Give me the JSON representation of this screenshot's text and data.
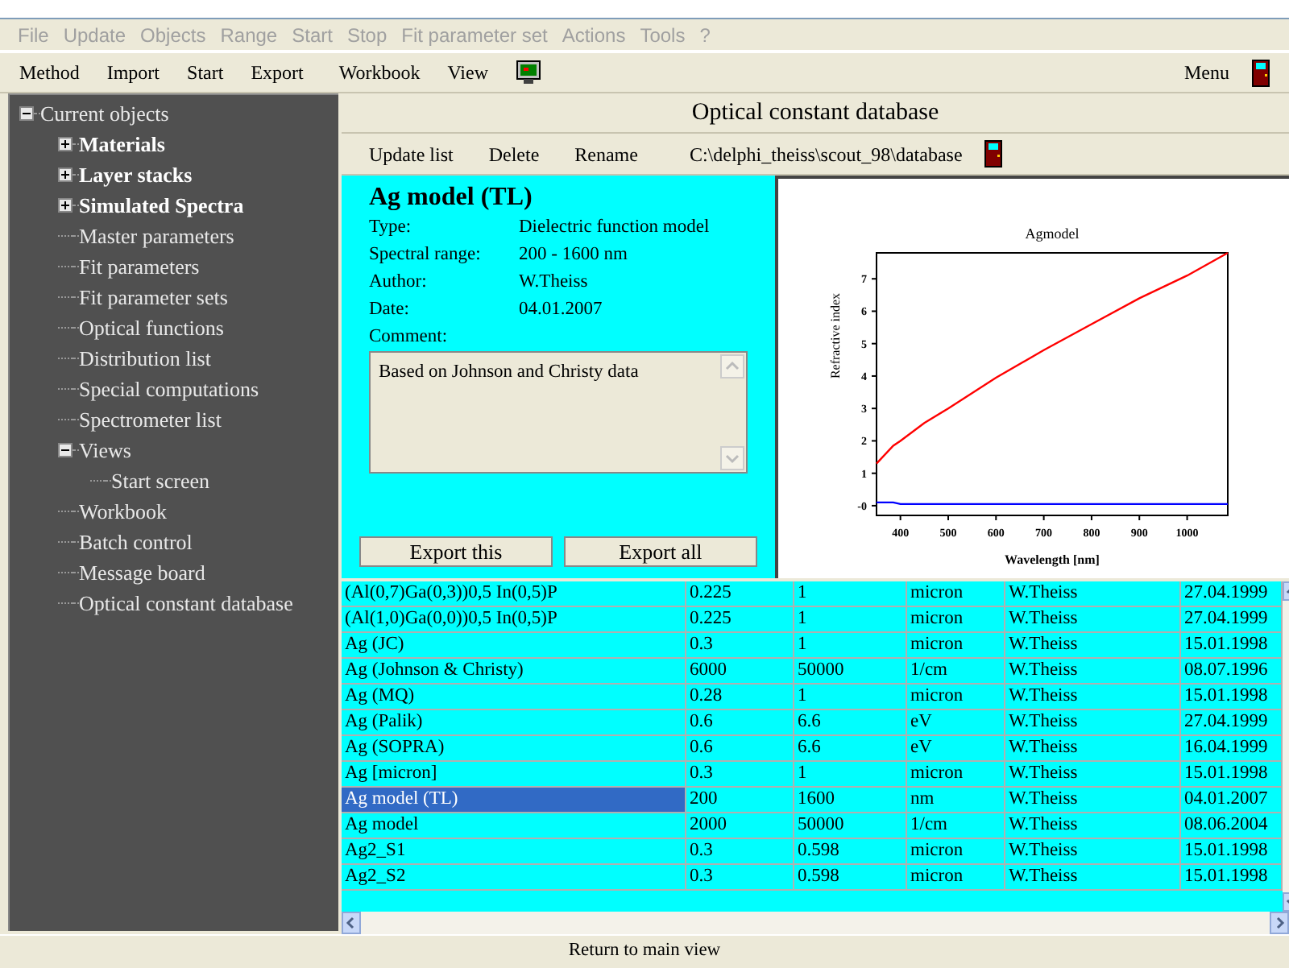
{
  "menu_bar": [
    "File",
    "Update",
    "Objects",
    "Range",
    "Start",
    "Stop",
    "Fit parameter set",
    "Actions",
    "Tools",
    "?"
  ],
  "toolbar": {
    "left": [
      "Method",
      "Import",
      "Start",
      "Export",
      "Workbook",
      "View"
    ],
    "right": "Menu"
  },
  "tree": {
    "label": "Current objects",
    "expanded": true,
    "children": [
      {
        "label": "Materials",
        "kind": "category",
        "expanded": false
      },
      {
        "label": "Layer stacks",
        "kind": "category",
        "expanded": false
      },
      {
        "label": "Simulated Spectra",
        "kind": "category",
        "expanded": false
      },
      {
        "label": "Master parameters",
        "kind": "item"
      },
      {
        "label": "Fit parameters",
        "kind": "item"
      },
      {
        "label": "Fit parameter sets",
        "kind": "item"
      },
      {
        "label": "Optical functions",
        "kind": "item"
      },
      {
        "label": "Distribution list",
        "kind": "item"
      },
      {
        "label": "Special computations",
        "kind": "item"
      },
      {
        "label": "Spectrometer list",
        "kind": "item"
      },
      {
        "label": "Views",
        "kind": "item",
        "expanded": true,
        "children": [
          {
            "label": "Start screen",
            "kind": "item"
          }
        ]
      },
      {
        "label": "Workbook",
        "kind": "item"
      },
      {
        "label": "Batch control",
        "kind": "item"
      },
      {
        "label": "Message board",
        "kind": "item"
      },
      {
        "label": "Optical constant database",
        "kind": "item"
      }
    ]
  },
  "panel": {
    "title": "Optical constant database",
    "toolbar": [
      "Update list",
      "Delete",
      "Rename"
    ],
    "path": "C:\\delphi_theiss\\scout_98\\database",
    "details": {
      "name": "Ag model (TL)",
      "fields": [
        {
          "label": "Type:",
          "value": "Dielectric function model"
        },
        {
          "label": "Spectral range:",
          "value": "200 - 1600 nm"
        },
        {
          "label": "Author:",
          "value": "W.Theiss"
        },
        {
          "label": "Date:",
          "value": "04.01.2007"
        }
      ],
      "comment_label": "Comment:",
      "comment": "Based on Johnson and Christy data",
      "buttons": [
        "Export this",
        "Export all"
      ]
    },
    "chart_data": {
      "type": "line",
      "title": "Agmodel",
      "xlabel": "Wavelength [nm]",
      "ylabel": "Refractive index",
      "x": [
        350,
        385,
        400,
        450,
        500,
        600,
        700,
        800,
        900,
        1000,
        1085
      ],
      "series": [
        {
          "color": "#ff0000",
          "values": [
            1.3,
            1.85,
            2.0,
            2.55,
            3.0,
            3.95,
            4.8,
            5.6,
            6.4,
            7.1,
            7.8
          ]
        },
        {
          "color": "#0000ff",
          "values": [
            0.1,
            0.1,
            0.05,
            0.05,
            0.05,
            0.05,
            0.05,
            0.05,
            0.05,
            0.05,
            0.05
          ]
        }
      ],
      "xlim": [
        350,
        1085
      ],
      "ylim": [
        -0.3,
        7.8
      ],
      "xticks": [
        400,
        500,
        600,
        700,
        800,
        900,
        1000
      ],
      "yticks": [
        {
          "value": 0,
          "label": "-0"
        },
        1,
        2,
        3,
        4,
        5,
        6,
        7
      ]
    },
    "table": {
      "rows": [
        {
          "cells": [
            "(Al(0,7)Ga(0,3))0,5 In(0,5)P",
            "0.225",
            "1",
            "micron",
            "W.Theiss",
            "27.04.1999"
          ],
          "selected": false
        },
        {
          "cells": [
            "(Al(1,0)Ga(0,0))0,5 In(0,5)P",
            "0.225",
            "1",
            "micron",
            "W.Theiss",
            "27.04.1999"
          ],
          "selected": false
        },
        {
          "cells": [
            "Ag (JC)",
            "0.3",
            "1",
            "micron",
            "W.Theiss",
            "15.01.1998"
          ],
          "selected": false
        },
        {
          "cells": [
            "Ag (Johnson & Christy)",
            "6000",
            "50000",
            "1/cm",
            "W.Theiss",
            "08.07.1996"
          ],
          "selected": false
        },
        {
          "cells": [
            "Ag (MQ)",
            "0.28",
            "1",
            "micron",
            "W.Theiss",
            "15.01.1998"
          ],
          "selected": false
        },
        {
          "cells": [
            "Ag (Palik)",
            "0.6",
            "6.6",
            "eV",
            "W.Theiss",
            "27.04.1999"
          ],
          "selected": false
        },
        {
          "cells": [
            "Ag (SOPRA)",
            "0.6",
            "6.6",
            "eV",
            "W.Theiss",
            "16.04.1999"
          ],
          "selected": false
        },
        {
          "cells": [
            "Ag [micron]",
            "0.3",
            "1",
            "micron",
            "W.Theiss",
            "15.01.1998"
          ],
          "selected": false
        },
        {
          "cells": [
            "Ag model (TL)",
            "200",
            "1600",
            "nm",
            "W.Theiss",
            "04.01.2007"
          ],
          "selected": true
        },
        {
          "cells": [
            "Ag model",
            "2000",
            "50000",
            "1/cm",
            "W.Theiss",
            "08.06.2004"
          ],
          "selected": false
        },
        {
          "cells": [
            "Ag2_S1",
            "0.3",
            "0.598",
            "micron",
            "W.Theiss",
            "15.01.1998"
          ],
          "selected": false
        },
        {
          "cells": [
            "Ag2_S2",
            "0.3",
            "0.598",
            "micron",
            "W.Theiss",
            "15.01.1998"
          ],
          "selected": false
        }
      ]
    }
  },
  "status_bar": "Return to main view"
}
